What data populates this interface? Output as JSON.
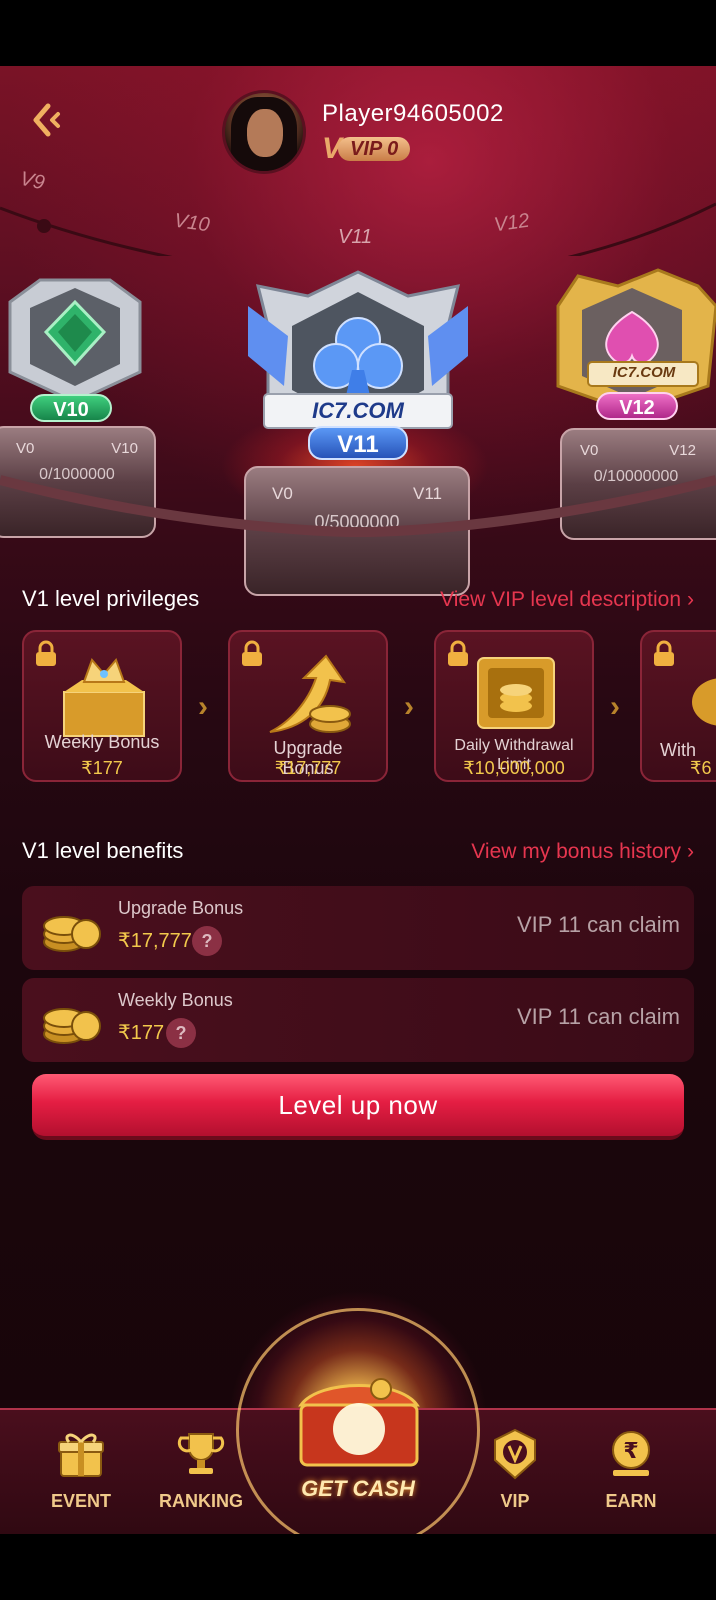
{
  "header": {
    "player_name": "Player94605002",
    "vip_letter": "V",
    "vip_level": "VIP 0"
  },
  "track": {
    "levels": [
      "V9",
      "V10",
      "V11",
      "V12"
    ],
    "current": "V11"
  },
  "trophies": [
    {
      "name": "V10",
      "range_start": "V0",
      "range_end": "V10",
      "progress": "0/1000000",
      "gem_color": "#2fb36a"
    },
    {
      "name": "V11",
      "range_start": "V0",
      "range_end": "V11",
      "progress": "0/5000000",
      "gem_color": "#3f7ee8",
      "brand": "IC7.COM"
    },
    {
      "name": "V12",
      "range_start": "V0",
      "range_end": "V12",
      "progress": "0/10000000",
      "gem_color": "#e04fb0",
      "brand": "IC7.COM"
    }
  ],
  "privileges": {
    "title": "V1 level privileges",
    "link": "View VIP level description",
    "items": [
      {
        "label": "Weekly Bonus",
        "value": "₹177"
      },
      {
        "label": "Upgrade Bonus",
        "value": "₹17,777"
      },
      {
        "label": "Daily Withdrawal Limit",
        "value": "₹10,000,000"
      },
      {
        "label": "With",
        "value": "₹6"
      }
    ]
  },
  "benefits": {
    "title": "V1 level benefits",
    "link": "View my bonus history",
    "items": [
      {
        "title": "Upgrade Bonus",
        "value": "₹17,777",
        "status": "VIP 11 can claim"
      },
      {
        "title": "Weekly Bonus",
        "value": "₹177",
        "status": "VIP 11 can claim"
      }
    ]
  },
  "level_up_button": "Level up now",
  "nav": {
    "event": "EVENT",
    "ranking": "RANKING",
    "get_cash": "GET CASH",
    "vip": "VIP",
    "earn": "EARN"
  },
  "colors": {
    "accent_red": "#e6364f",
    "gold": "#f2c94c"
  }
}
